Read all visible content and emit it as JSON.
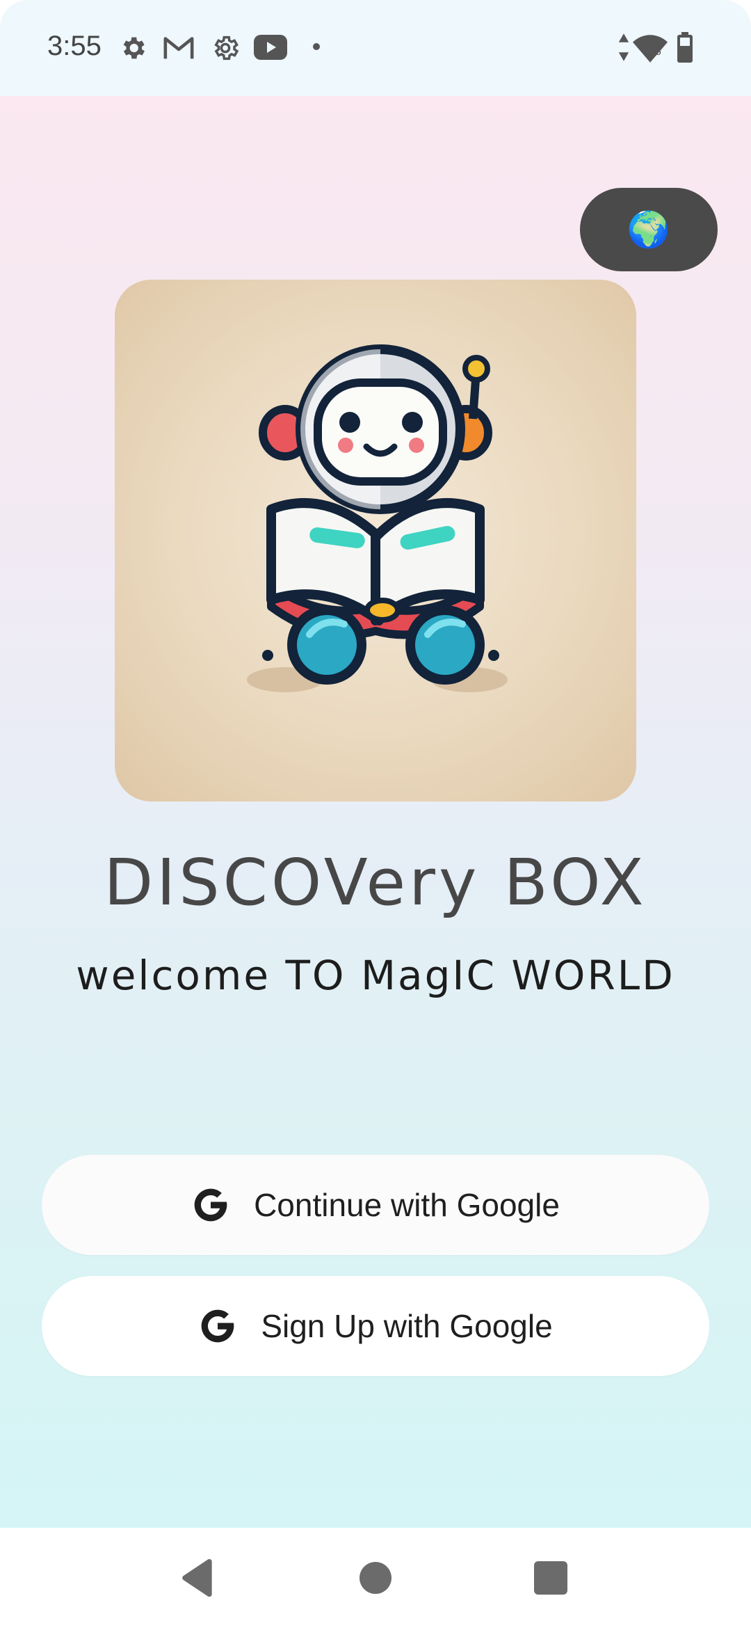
{
  "status_bar": {
    "time": "3:55",
    "notification_icons": [
      "settings-icon",
      "gmail-icon",
      "settings-icon",
      "youtube-icon",
      "dot-icon"
    ],
    "system_icons": [
      "data-arrows-icon",
      "wifi-icon",
      "battery-icon"
    ],
    "wifi_badge": "5"
  },
  "app": {
    "language_button_icon": "globe-icon",
    "language_button_emoji": "🌍",
    "title": "DISCOVery BOX",
    "subtitle": "welcome TO MagIC WORLD",
    "buttons": {
      "continue_label": "Continue with Google",
      "signup_label": "Sign Up with Google",
      "icon": "google-g-icon"
    },
    "colors": {
      "background_top": "#fbe8f0",
      "background_bottom": "#d5f5f6",
      "language_button": "#4a4a4a",
      "hero_card": "#e3cfb1",
      "title": "#474747",
      "subtitle": "#1d1d1d"
    }
  },
  "nav_bar": {
    "icons": [
      "back-icon",
      "home-icon",
      "recents-icon"
    ]
  }
}
